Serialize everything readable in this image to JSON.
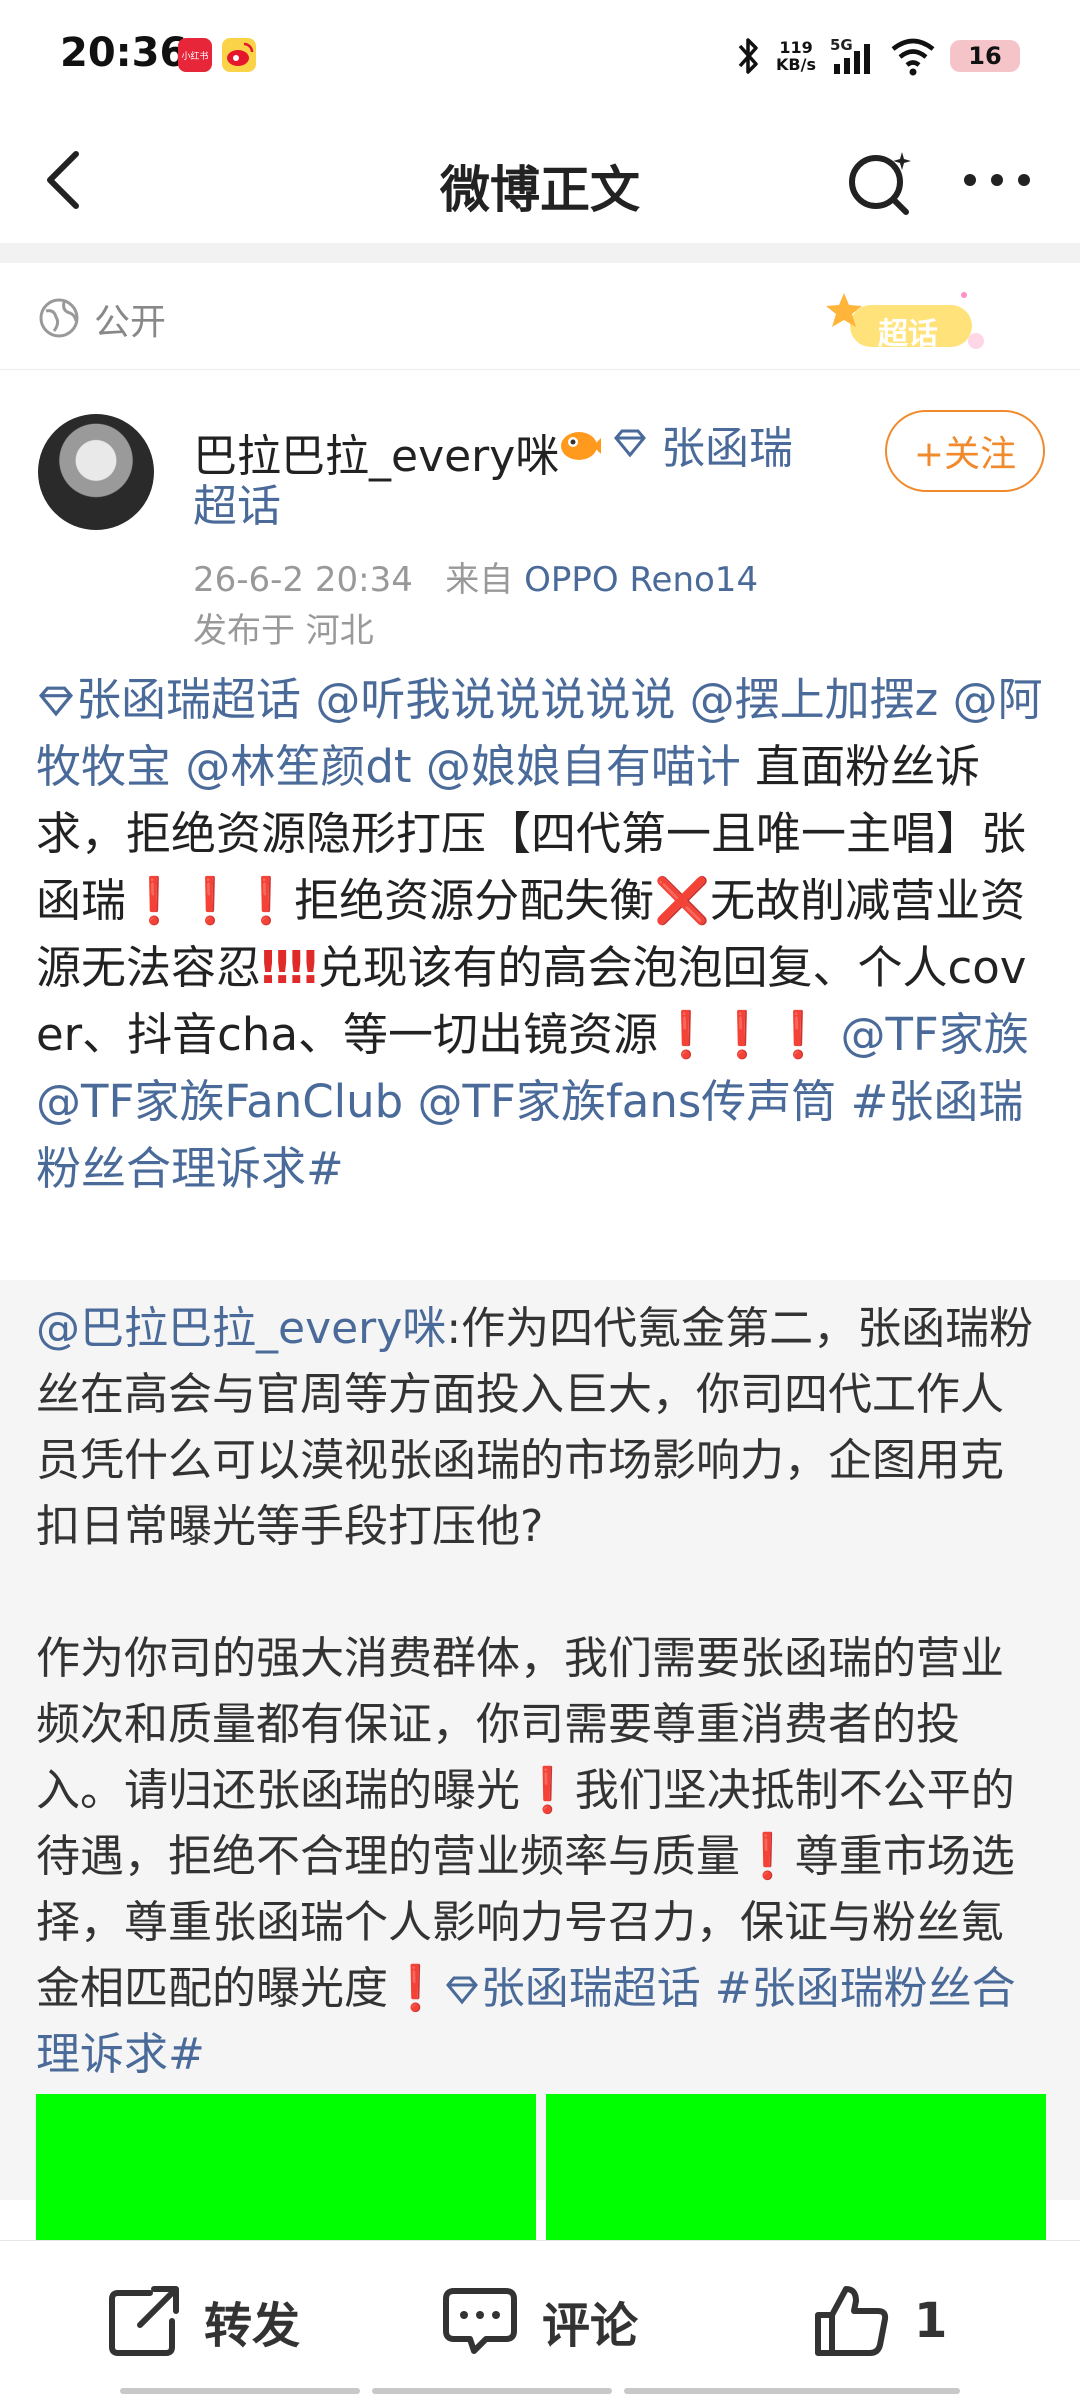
{
  "status_bar": {
    "time": "20:36",
    "app_badge_1": "小红书",
    "net_speed_value": "119",
    "net_speed_unit": "KB/s",
    "network": "5G",
    "battery": "16"
  },
  "nav": {
    "title": "微博正文",
    "icons": [
      "back-icon",
      "search-icon",
      "more-icon"
    ]
  },
  "visibility": {
    "label": "公开",
    "badge": "超话"
  },
  "author": {
    "name": "巴拉巴拉_every咪",
    "topic": "张函瑞超话",
    "follow_label": "+关注",
    "time": "26-6-2 20:34",
    "source_prefix": "来自",
    "device": "OPPO Reno14",
    "location": "发布于 河北"
  },
  "post": {
    "topic": "张函瑞超话",
    "m1": "@听我说说说说说",
    "m2": "@摆上加摆z",
    "m3": "@阿牧牧宝",
    "m4": "@林笙颜dt",
    "m5": "@娘娘自有喵计",
    "t1": " 直面粉丝诉求，拒绝资源隐形打压【四代第一且唯一主唱】张函瑞",
    "t2": "拒绝资源分配失衡",
    "t3": "无故削减营业资源无法容忍",
    "t4": "兑现该有的高会泡泡回复、个人cover、抖音cha、等一切出镜资源",
    "m6": "@TF家族",
    "m7": "@TF家族FanClub",
    "m8": "@TF家族fans传声筒",
    "hashtag": "#张函瑞粉丝合理诉求#"
  },
  "quoted": {
    "mention": "@巴拉巴拉_every咪",
    "p1": ":作为四代氪金第二，张函瑞粉丝在高会与官周等方面投入巨大，你司四代工作人员凭什么可以漠视张函瑞的市场影响力，企图用克扣日常曝光等手段打压他?",
    "p2a": "作为你司的强大消费群体，我们需要张函瑞的营业频次和质量都有保证，你司需要尊重消费者的投入。请归还张函瑞的曝光",
    "p2b": "我们坚决抵制不公平的待遇，拒绝不合理的营业频率与质量",
    "p2c": "尊重市场选择，尊重张函瑞个人影响力号召力，保证与粉丝氪金相匹配的曝光度",
    "topic": "张函瑞超话",
    "hashtag": "#张函瑞粉丝合理诉求#",
    "image_color": "#00ff00"
  },
  "actions": {
    "repost": "转发",
    "comment": "评论",
    "like_count": "1"
  },
  "colors": {
    "link": "#4a6a99",
    "accent_orange": "#f08a2c",
    "alert_red": "#e02a2a"
  }
}
